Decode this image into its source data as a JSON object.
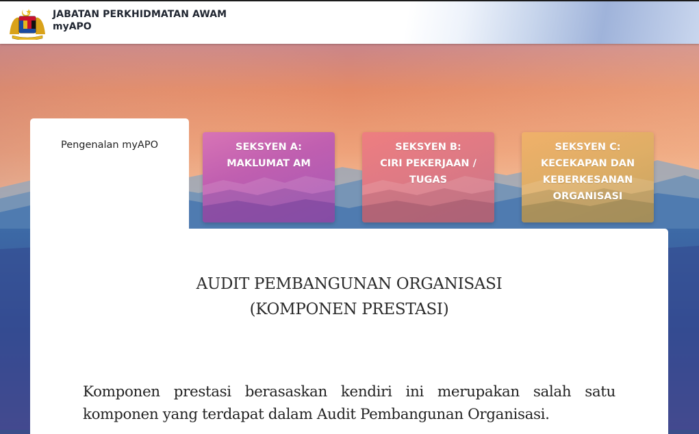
{
  "header": {
    "org_name": "JABATAN PERKHIDMATAN AWAM",
    "app_name": "myAPO",
    "logo": "malaysia-coat-of-arms-icon"
  },
  "tabs": {
    "intro_label": "Pengenalan myAPO",
    "sections": [
      {
        "line1": "SEKSYEN A:",
        "line2": "MAKLUMAT AM",
        "line3": "",
        "line4": ""
      },
      {
        "line1": "SEKSYEN B:",
        "line2": "CIRI PEKERJAAN /",
        "line3": "TUGAS",
        "line4": ""
      },
      {
        "line1": "SEKSYEN C:",
        "line2": "KECEKAPAN DAN",
        "line3": "KEBERKESANAN",
        "line4": "ORGANISASI"
      }
    ]
  },
  "content": {
    "title_line1": "AUDIT PEMBANGUNAN ORGANISASI",
    "title_line2": "(KOMPONEN PRESTASI)",
    "body": "Komponen prestasi berasaskan kendiri ini merupakan salah satu komponen yang terdapat dalam Audit Pembangunan Organisasi."
  },
  "colors": {
    "section_a": "#c25fb1",
    "section_b": "#e07a84",
    "section_c": "#dfae66",
    "sky_top": "#e78a66",
    "sky_mid": "#f0b48f",
    "mountains": "#4a7fae"
  }
}
